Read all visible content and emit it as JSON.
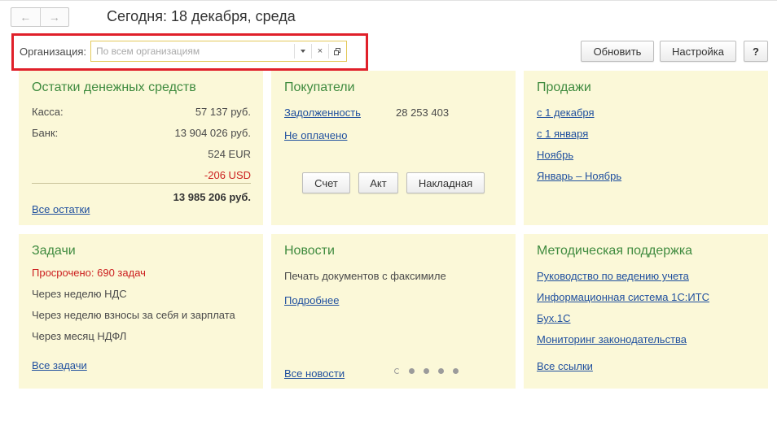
{
  "header": {
    "back_icon": "arrow-left-icon",
    "forward_icon": "arrow-right-icon",
    "title": "Сегодня: 18 декабря, среда"
  },
  "filter": {
    "org_label": "Организация:",
    "org_placeholder": "По всем организациям",
    "org_value": ""
  },
  "toolbar": {
    "refresh": "Обновить",
    "settings": "Настройка",
    "help": "?"
  },
  "panels": {
    "balances": {
      "title": "Остатки денежных средств",
      "cash_label": "Касса:",
      "cash_value": "57 137 руб.",
      "bank_label": "Банк:",
      "bank_value": "13 904 026 руб.",
      "eur_value": "524 EUR",
      "usd_value": "-206 USD",
      "total_value": "13 985 206 руб.",
      "all_link": "Все остатки"
    },
    "customers": {
      "title": "Покупатели",
      "debt_link": "Задолженность",
      "debt_value": "28 253 403",
      "unpaid_link": "Не оплачено",
      "invoice_button": "Счет",
      "act_button": "Акт",
      "waybill_button": "Накладная"
    },
    "sales": {
      "title": "Продажи",
      "links": [
        "с 1 декабря",
        "с 1 января",
        "Ноябрь",
        "Январь – Ноябрь"
      ]
    },
    "tasks": {
      "title": "Задачи",
      "overdue": "Просрочено: 690 задач",
      "items": [
        "Через неделю НДС",
        "Через неделю взносы за себя и зарплата",
        "Через месяц НДФЛ"
      ],
      "all_link": "Все задачи"
    },
    "news": {
      "title": "Новости",
      "headline": "Печать документов с факсимиле",
      "more_link": "Подробнее",
      "all_link": "Все новости",
      "pager_dots": 5
    },
    "support": {
      "title": "Методическая поддержка",
      "links": [
        "Руководство по ведению учета",
        "Информационная система 1С:ИТС",
        "Бух.1С",
        "Мониторинг законодательства"
      ],
      "all_link": "Все ссылки"
    }
  },
  "colors": {
    "panel_bg": "#fbf8d8",
    "panel_title": "#3f8b3f",
    "link": "#1f4f9e",
    "negative": "#cc2020",
    "highlight_frame": "#e0202a"
  }
}
